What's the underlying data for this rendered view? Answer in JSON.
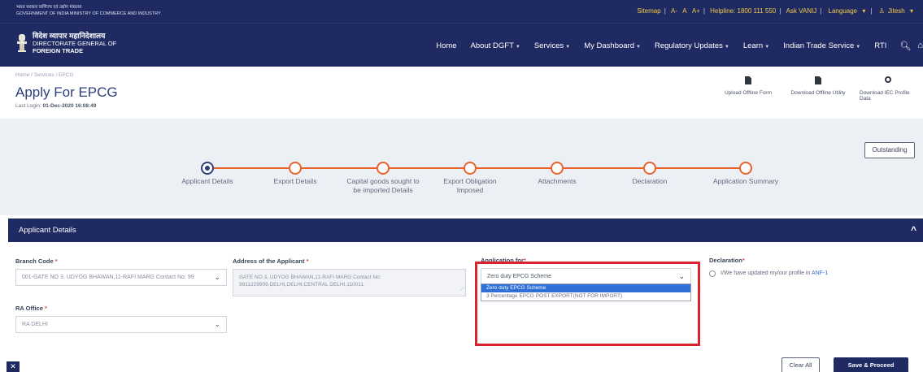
{
  "gov_header": {
    "hindi": "भारत सरकार  वाणिज्य एवं उद्योग मंत्रालय",
    "english": "GOVERNMENT OF INDIA  MINISTRY OF COMMERCE AND INDUSTRY"
  },
  "top_links": {
    "sitemap": "Sitemap",
    "font_minus": "A-",
    "font_normal": "A",
    "font_plus": "A+",
    "helpline": "Helpline: 1800 111 550",
    "ask": "Ask VANIJ",
    "language": "Language",
    "user": "Jitesh"
  },
  "logo": {
    "hindi": "विदेश व्यापार महानिदेशालय",
    "line1": "DIRECTORATE GENERAL OF",
    "line2": "FOREIGN TRADE"
  },
  "nav": {
    "items": [
      {
        "label": "Home",
        "caret": false
      },
      {
        "label": "About DGFT",
        "caret": true
      },
      {
        "label": "Services",
        "caret": true
      },
      {
        "label": "My Dashboard",
        "caret": true
      },
      {
        "label": "Regulatory Updates",
        "caret": true
      },
      {
        "label": "Learn",
        "caret": true
      },
      {
        "label": "Indian Trade Service",
        "caret": true
      },
      {
        "label": "RTI",
        "caret": false
      }
    ]
  },
  "breadcrumb": "Home / Services / EPCG",
  "page": {
    "title": "Apply For EPCG",
    "last_login_label": "Last Login:",
    "last_login_value": "01-Dec-2020 16:08:49"
  },
  "tools": {
    "upload": "Upload Offline Form",
    "download_utility": "Download Offline Utility",
    "download_iec": "Download IEC Profile Data"
  },
  "outstanding_button": "Outstanding",
  "steps": [
    {
      "label": "Applicant Details",
      "active": true
    },
    {
      "label": "Export Details",
      "active": false
    },
    {
      "label": "Capital goods sought to be imported Details",
      "active": false
    },
    {
      "label": "Export Obligation Imposed",
      "active": false
    },
    {
      "label": "Attachments",
      "active": false
    },
    {
      "label": "Declaration",
      "active": false
    },
    {
      "label": "Application Summary",
      "active": false
    }
  ],
  "section": {
    "title": "Applicant Details"
  },
  "form": {
    "branch_code_label": "Branch Code",
    "branch_code_value": "001-GATE NO 3, UDYOG BHAWAN,11-RAFI MARG Contact No: 99",
    "address_label": "Address of the Applicant",
    "address_value": "GATE NO 3, UDYOG BHAWAN,11-RAFI MARG Contact No: 9911229909,DELHI,DELHI,CENTRAL DELHI,110011.",
    "ra_office_label": "RA Office",
    "ra_office_value": "RA DELHI",
    "application_for_label": "Application for",
    "application_for_value": "Zero duty EPCG Scheme",
    "application_for_options": [
      "Zero duty EPCG Scheme",
      "3 Percentage EPCG POST EXPORT(NOT FOR IMPORT)"
    ],
    "declaration_label": "Declaration",
    "declaration_text": "I/We have updated my/our profile in",
    "declaration_link": "ANF-1"
  },
  "buttons": {
    "clear_all": "Clear All",
    "save_proceed": "Save & Proceed"
  },
  "colors": {
    "navy": "#1f2a63",
    "accent_orange": "#e8632b",
    "highlight_red": "#d9232e",
    "link_gold": "#f0c94a"
  }
}
